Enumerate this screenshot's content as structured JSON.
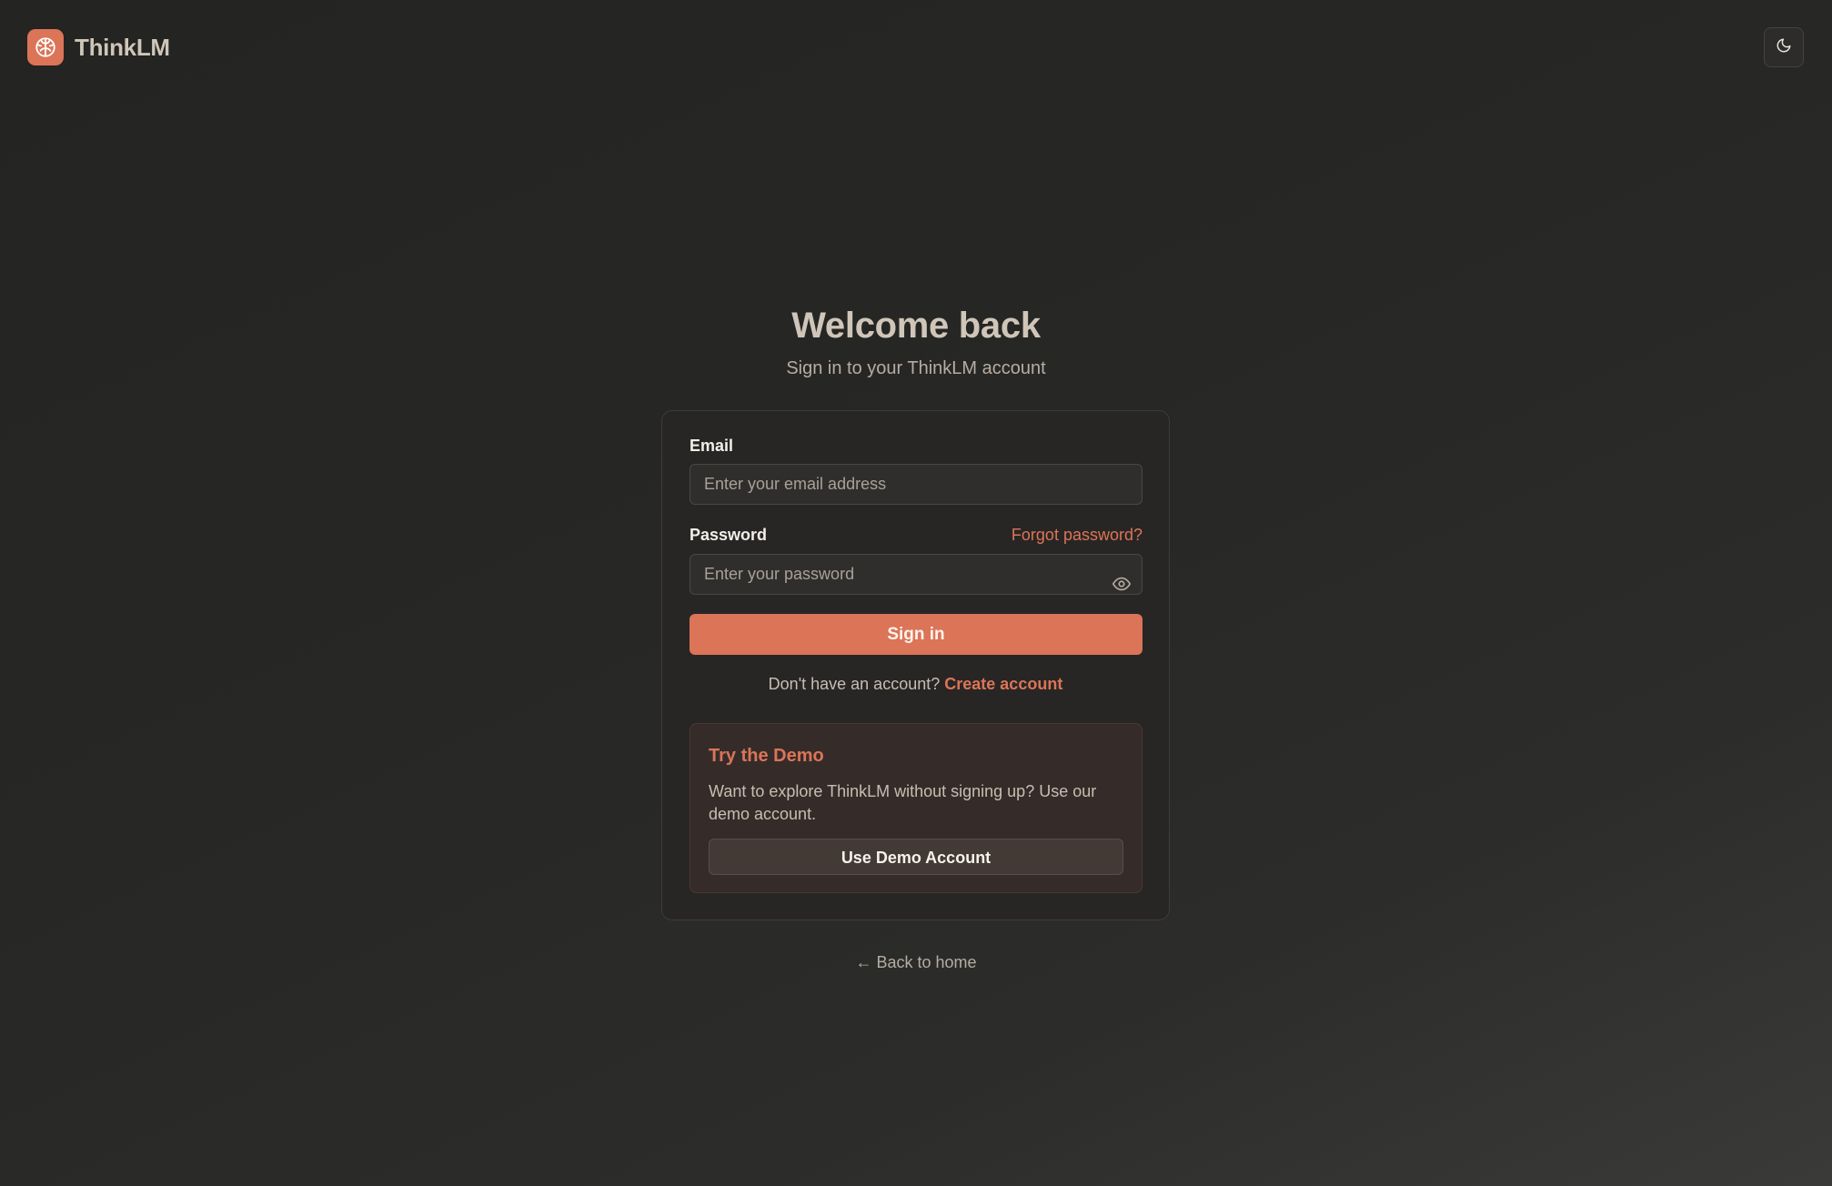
{
  "app": {
    "name": "ThinkLM",
    "logo_icon": "brain-icon",
    "theme_toggle_icon": "moon-icon",
    "accent_color": "#dc7458"
  },
  "header": {
    "title": "Welcome back",
    "subtitle": "Sign in to your ThinkLM account"
  },
  "form": {
    "email_label": "Email",
    "email_placeholder": "Enter your email address",
    "email_value": "",
    "password_label": "Password",
    "password_placeholder": "Enter your password",
    "password_value": "",
    "password_visibility_icon": "eye-icon",
    "forgot_password": "Forgot password?",
    "submit_label": "Sign in",
    "signup_prompt": "Don't have an account?",
    "signup_link": "Create account"
  },
  "demo": {
    "title": "Try the Demo",
    "description": "Want to explore ThinkLM without signing up? Use our demo account.",
    "button_label": "Use Demo Account"
  },
  "footer": {
    "back_link": "← Back to home"
  }
}
